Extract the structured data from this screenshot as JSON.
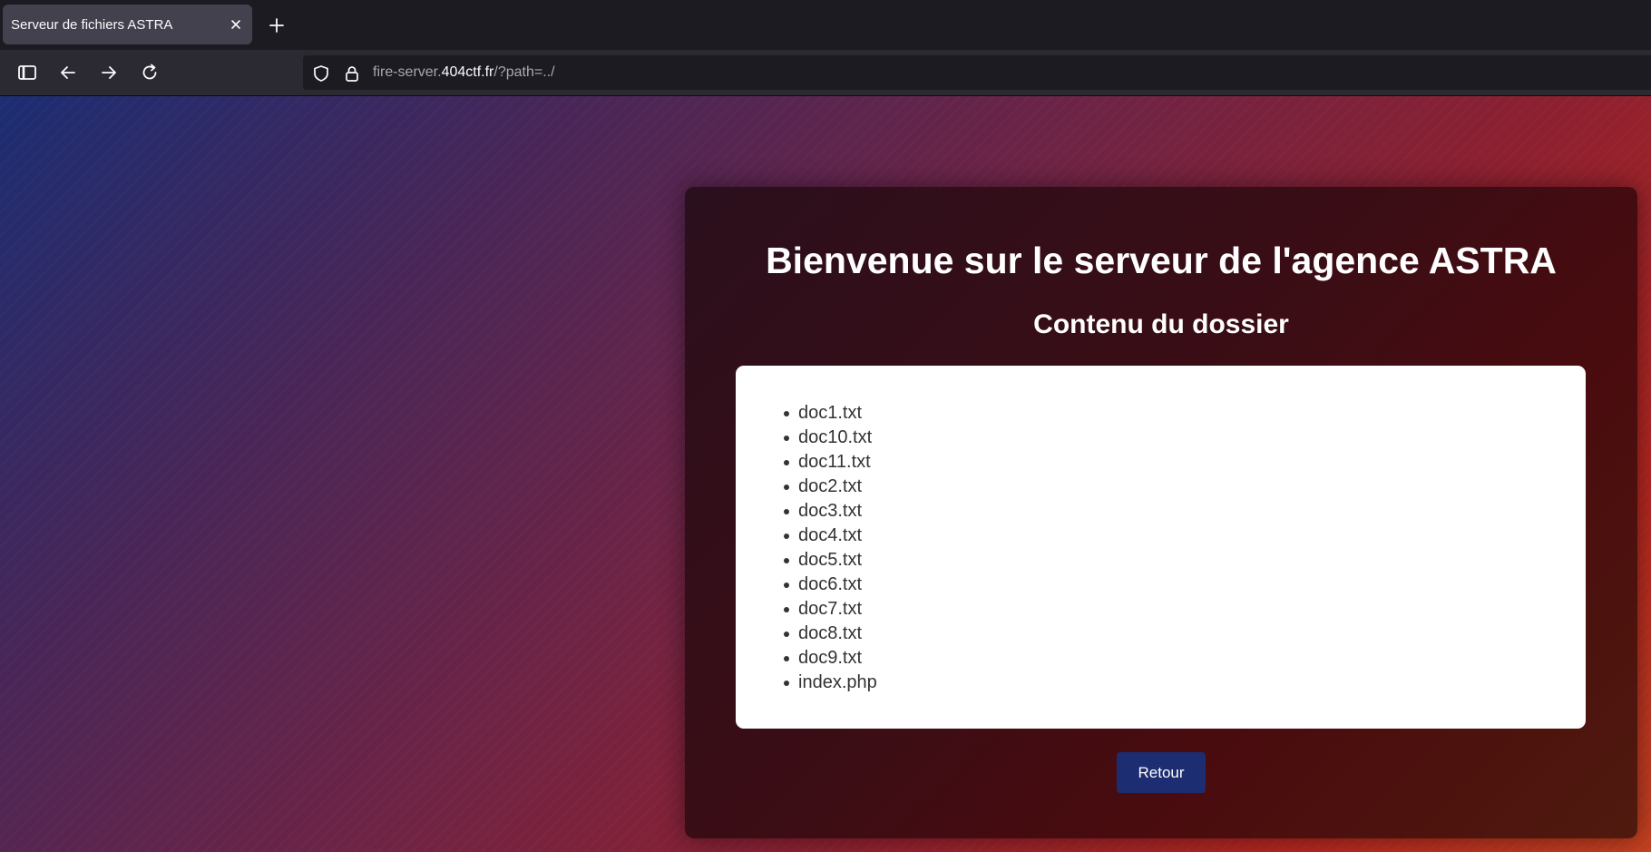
{
  "browser": {
    "tab": {
      "title": "Serveur de fichiers ASTRA"
    },
    "address_bar": {
      "url_prefix": "fire-server.",
      "url_host": "404ctf.fr",
      "url_suffix": "/?path=../"
    }
  },
  "page": {
    "title": "Bienvenue sur le serveur de l'agence ASTRA",
    "subtitle": "Contenu du dossier",
    "files": [
      "doc1.txt",
      "doc10.txt",
      "doc11.txt",
      "doc2.txt",
      "doc3.txt",
      "doc4.txt",
      "doc5.txt",
      "doc6.txt",
      "doc7.txt",
      "doc8.txt",
      "doc9.txt",
      "index.php"
    ],
    "back_button_label": "Retour"
  },
  "colors": {
    "browser_chrome": "#1c1b22",
    "toolbar": "#2b2a33",
    "active_tab": "#42414d",
    "card_background": "#3b0d15",
    "button_background": "#1c2d72",
    "gradient_start": "#1c2d72",
    "gradient_end": "#c2401f"
  },
  "icons": {
    "tab_close": "close-icon",
    "new_tab": "plus-icon",
    "sidebar": "sidebar-icon",
    "back": "arrow-left-icon",
    "forward": "arrow-right-icon",
    "reload": "reload-icon",
    "tracking_protection": "shield-icon",
    "secure_connection": "lock-icon"
  }
}
